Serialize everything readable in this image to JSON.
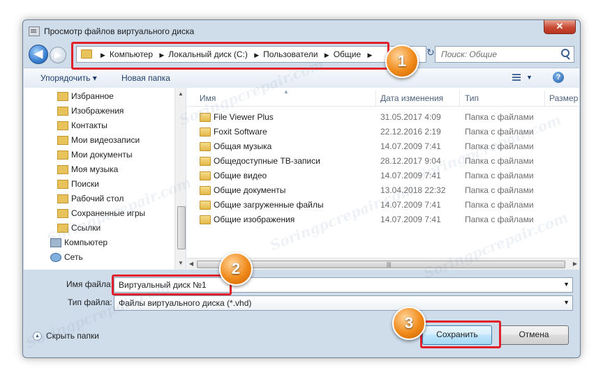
{
  "window": {
    "title": "Просмотр файлов виртуального диска",
    "close_glyph": "✕"
  },
  "nav": {
    "back_glyph": "◀",
    "forward_glyph": "▶",
    "breadcrumbs": [
      "Компьютер",
      "Локальный диск (C:)",
      "Пользователи",
      "Общие"
    ],
    "refresh_glyph": "↻",
    "search_placeholder": "Поиск: Общие"
  },
  "toolbar": {
    "organize_label": "Упорядочить ▾",
    "new_folder_label": "Новая папка"
  },
  "nav_pane": {
    "items": [
      {
        "label": "Избранное",
        "icon": "star-icon"
      },
      {
        "label": "Изображения",
        "icon": "folder-icon"
      },
      {
        "label": "Контакты",
        "icon": "folder-icon"
      },
      {
        "label": "Мои видеозаписи",
        "icon": "folder-icon"
      },
      {
        "label": "Мои документы",
        "icon": "folder-icon"
      },
      {
        "label": "Моя музыка",
        "icon": "folder-icon"
      },
      {
        "label": "Поиски",
        "icon": "folder-icon"
      },
      {
        "label": "Рабочий стол",
        "icon": "folder-icon"
      },
      {
        "label": "Сохраненные игры",
        "icon": "folder-icon"
      },
      {
        "label": "Ссылки",
        "icon": "folder-icon"
      },
      {
        "label": "Компьютер",
        "icon": "computer-icon"
      },
      {
        "label": "Сеть",
        "icon": "network-icon"
      }
    ]
  },
  "file_list": {
    "columns": [
      "Имя",
      "Дата изменения",
      "Тип",
      "Размер"
    ],
    "rows": [
      {
        "name": "File Viewer Plus",
        "date": "31.05.2017 4:09",
        "type": "Папка с файлами"
      },
      {
        "name": "Foxit Software",
        "date": "22.12.2016 2:19",
        "type": "Папка с файлами"
      },
      {
        "name": "Общая музыка",
        "date": "14.07.2009 7:41",
        "type": "Папка с файлами"
      },
      {
        "name": "Общедоступные ТВ-записи",
        "date": "28.12.2017 9:04",
        "type": "Папка с файлами"
      },
      {
        "name": "Общие видео",
        "date": "14.07.2009 7:41",
        "type": "Папка с файлами"
      },
      {
        "name": "Общие документы",
        "date": "13.04.2018 22:32",
        "type": "Папка с файлами"
      },
      {
        "name": "Общие загруженные файлы",
        "date": "14.07.2009 7:41",
        "type": "Папка с файлами"
      },
      {
        "name": "Общие изображения",
        "date": "14.07.2009 7:41",
        "type": "Папка с файлами"
      }
    ]
  },
  "form": {
    "filename_label": "Имя файла:",
    "filename_value": "Виртуальный диск №1",
    "filetype_label": "Тип файла:",
    "filetype_value": "Файлы виртуального диска (*.vhd)"
  },
  "footer": {
    "hide_folders_label": "Скрыть папки",
    "save_label": "Сохранить",
    "cancel_label": "Отмена"
  },
  "annotations": {
    "badges": [
      "1",
      "2",
      "3"
    ],
    "accent_red": "#e0202a",
    "badge_orange": "#f08a1a"
  },
  "watermark": "Soringpcrepair.com"
}
